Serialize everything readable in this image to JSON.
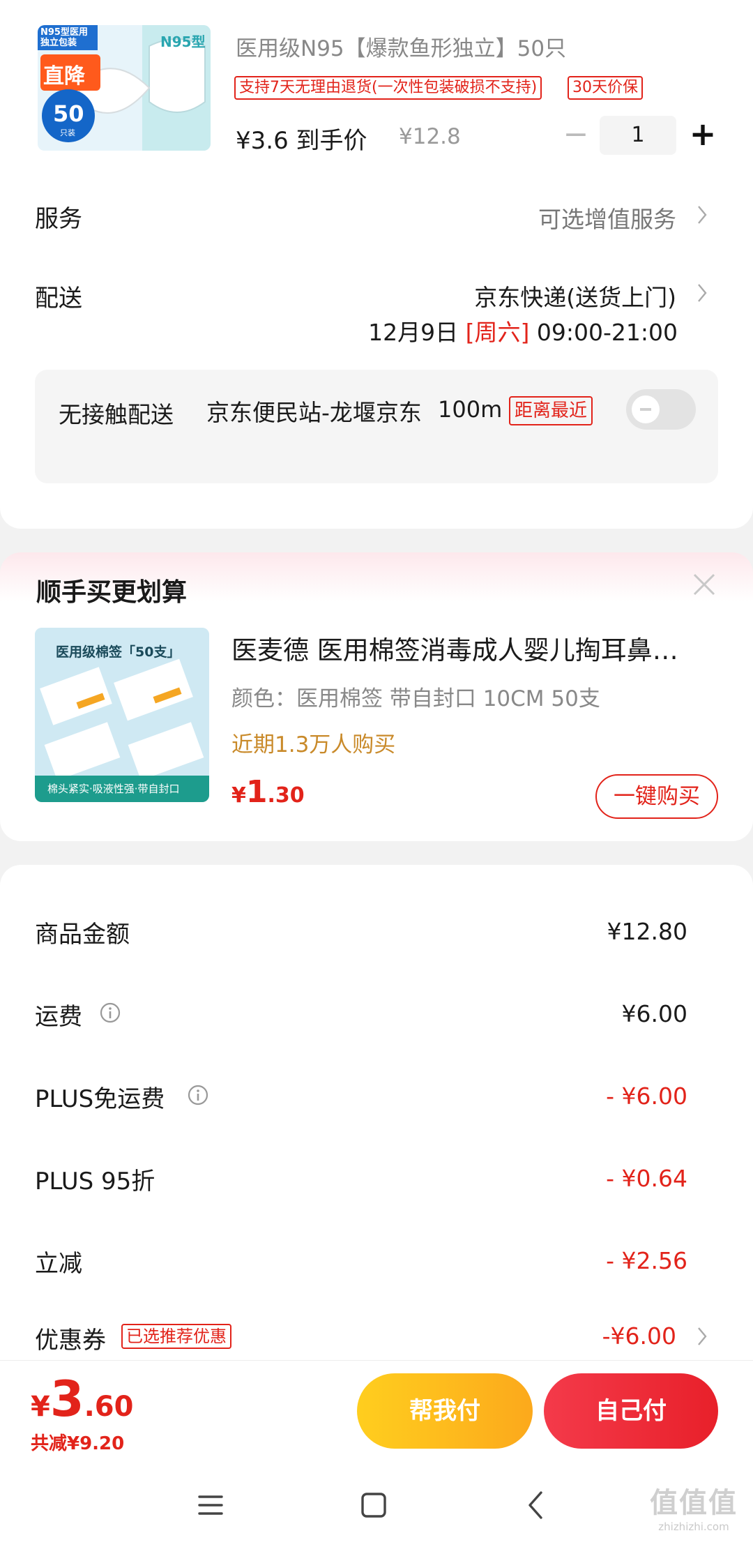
{
  "product": {
    "image_badges": {
      "top": "N95型医用独立包装",
      "main": "直降",
      "count": "50",
      "unit": "只装",
      "box_label": "N95型"
    },
    "title": "医用级N95【爆款鱼形独立】50只",
    "tags": [
      "支持7天无理由退货(一次性包装破损不支持)",
      "30天价保"
    ],
    "price_final": "¥3.6 到手价",
    "price_original": "¥12.8",
    "quantity": "1",
    "minus": "−",
    "plus": "+"
  },
  "service": {
    "label": "服务",
    "value": "可选增值服务"
  },
  "delivery": {
    "label": "配送",
    "method": "京东快递(送货上门)",
    "date": "12月9日",
    "weekday": "[周六]",
    "time": "09:00-21:00"
  },
  "contactless": {
    "label": "无接触配送",
    "station": "京东便民站-龙堰京东",
    "distance": "100m",
    "tag": "距离最近",
    "enabled": false
  },
  "addon": {
    "title": "顺手买更划算",
    "image_caption_top": "医用级棉签「50支」",
    "image_caption_bottom": "棉头紧实·吸液性强·带自封口",
    "name": "医麦德 医用棉签消毒成人婴儿掏耳鼻…",
    "spec": "颜色：医用棉签 带自封口 10CM 50支",
    "sales": "近期1.3万人购买",
    "price_currency": "¥",
    "price_int": "1",
    "price_dec": ".30",
    "buy_label": "一键购买"
  },
  "summary": {
    "rows": [
      {
        "label": "商品金额",
        "value": "¥12.80",
        "red": false,
        "info": false
      },
      {
        "label": "运费",
        "value": "¥6.00",
        "red": false,
        "info": true
      },
      {
        "label": "PLUS免运费",
        "value": "- ¥6.00",
        "red": true,
        "info": true
      },
      {
        "label": "PLUS 95折",
        "value": "- ¥0.64",
        "red": true,
        "info": false
      },
      {
        "label": "立减",
        "value": "- ¥2.56",
        "red": true,
        "info": false
      }
    ],
    "coupon": {
      "label": "优惠券",
      "tag": "已选推荐优惠",
      "value": "-¥6.00"
    }
  },
  "checkout": {
    "currency": "¥",
    "total_int": "3",
    "total_dec": ".60",
    "saved": "共减¥9.20",
    "help_pay": "帮我付",
    "self_pay": "自己付"
  },
  "watermark": {
    "line1": "值值值",
    "line2": "zhizhizhi.com"
  },
  "colors": {
    "accent_red": "#e2231a",
    "gold": "#c98a2a",
    "yellow_btn": "#fcb91c"
  }
}
